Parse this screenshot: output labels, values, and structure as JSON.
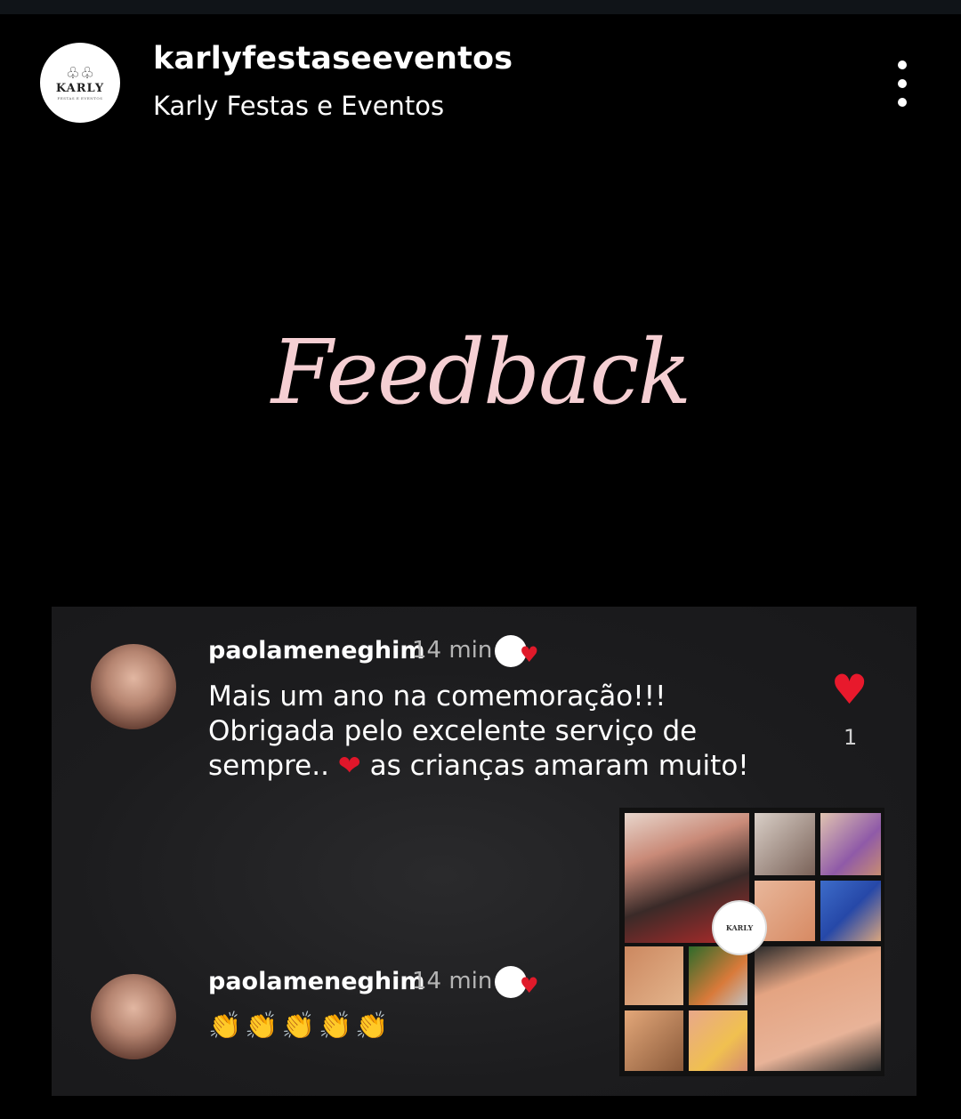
{
  "header": {
    "username": "karlyfestaseeventos",
    "display_name": "Karly Festas e Eventos",
    "logo": {
      "brand": "KARLY",
      "tagline": "FESTAS E EVENTOS"
    },
    "more_icon": "more-vertical-icon"
  },
  "story": {
    "title": "Feedback"
  },
  "comments": [
    {
      "username": "paolameneghim",
      "time": "14 min",
      "text_line1": "Mais um ano na comemoração!!!",
      "text_line2": "Obrigada pelo excelente serviço de",
      "text_line3_before": "sempre.. ",
      "text_heart": "❤",
      "text_line3_after": " as crianças amaram muito!",
      "like_icon": "heart-icon",
      "like_count": "1"
    },
    {
      "username": "paolameneghim",
      "time": "14 min",
      "emojis": "👏👏👏👏👏",
      "emoji_icon": "clapping-hands-icon"
    }
  ],
  "colors": {
    "background": "#000000",
    "title_pink": "#f5cfd3",
    "card": "#1c1c1e",
    "heart": "#e8192c",
    "muted_text": "#b5b5b5"
  }
}
